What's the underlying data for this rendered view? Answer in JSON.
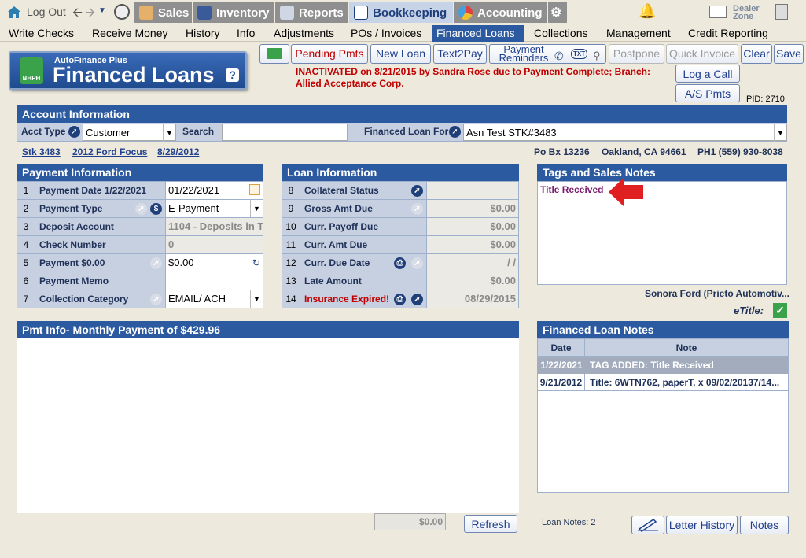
{
  "topbar": {
    "logout": "Log Out",
    "sales": "Sales",
    "inventory": "Inventory",
    "reports": "Reports",
    "bookkeeping": "Bookkeeping",
    "accounting": "Accounting",
    "dealer_zone": "Dealer Zone"
  },
  "menu": [
    "Write Checks",
    "Receive Money",
    "History",
    "Info",
    "Adjustments",
    "POs / Invoices",
    "Financed Loans",
    "Collections",
    "Management",
    "Credit Reporting"
  ],
  "logo": {
    "brand": "AutoFinance Plus",
    "title": "Financed Loans",
    "badge": "BHPH"
  },
  "toolbar": {
    "pending": "Pending Pmts",
    "new_loan": "New Loan",
    "text2pay": "Text2Pay",
    "reminders": "Payment Reminders",
    "txt": "TXT",
    "postpone": "Postpone",
    "quick_invoice": "Quick Invoice",
    "clear": "Clear",
    "save": "Save",
    "log_call": "Log a Call",
    "as_pmts": "A/S Pmts"
  },
  "alert": "INACTIVATED on 8/21/2015 by Sandra Rose due to Payment Complete; Branch: Allied Acceptance Corp.",
  "pid": "PID: 2710",
  "account": {
    "header": "Account Information",
    "acct_type_label": "Acct Type",
    "acct_type": "Customer",
    "search_label": "Search",
    "search_value": "",
    "financed_for_label": "Financed Loan For",
    "financed_for": "Asn Test STK#3483"
  },
  "vehicle": {
    "stock": "Stk 3483",
    "car": "2012 Ford Focus",
    "date": "8/29/2012"
  },
  "contact": {
    "address": "Po Bx 13236",
    "city": "Oakland, CA 94661",
    "phone": "PH1 (559) 930-8038"
  },
  "payment": {
    "header": "Payment Information",
    "rows": [
      {
        "n": "1",
        "label": "Payment Date  1/22/2021",
        "value": "01/22/2021"
      },
      {
        "n": "2",
        "label": "Payment Type",
        "value": "E-Payment"
      },
      {
        "n": "3",
        "label": "Deposit Account",
        "value": "1104 - Deposits in T"
      },
      {
        "n": "4",
        "label": "Check Number",
        "value": "0"
      },
      {
        "n": "5",
        "label": "Payment  $0.00",
        "value": "$0.00"
      },
      {
        "n": "6",
        "label": "Payment Memo",
        "value": ""
      },
      {
        "n": "7",
        "label": "Collection Category",
        "value": "EMAIL/ ACH"
      }
    ]
  },
  "loan": {
    "header": "Loan Information",
    "rows": [
      {
        "n": "8",
        "label": "Collateral Status",
        "value": ""
      },
      {
        "n": "9",
        "label": "Gross Amt Due",
        "value": "$0.00"
      },
      {
        "n": "10",
        "label": "Curr. Payoff Due",
        "value": "$0.00"
      },
      {
        "n": "11",
        "label": "Curr. Amt Due",
        "value": "$0.00"
      },
      {
        "n": "12",
        "label": "Curr. Due Date",
        "value": "/  /"
      },
      {
        "n": "13",
        "label": "Late Amount",
        "value": "$0.00"
      },
      {
        "n": "14",
        "label": "Insurance Expired!",
        "value": "08/29/2015"
      }
    ]
  },
  "tags": {
    "header": "Tags and Sales Notes",
    "items": [
      "Title Received"
    ]
  },
  "dealer": "Sonora Ford (Prieto Automotiv...",
  "etitle": "eTitle:",
  "pmt_info": {
    "header": "Pmt Info- Monthly Payment of $429.96",
    "total": "$0.00",
    "refresh": "Refresh"
  },
  "notes": {
    "header": "Financed Loan Notes",
    "col_date": "Date",
    "col_note": "Note",
    "rows": [
      {
        "date": "1/22/2021",
        "note": "TAG ADDED: Title Received"
      },
      {
        "date": "9/21/2012",
        "note": "Title:  6WTN762, paperT,  x 09/02/20137/14..."
      }
    ],
    "count_label": "Loan Notes:  2",
    "letter_history": "Letter History",
    "notes_btn": "Notes"
  },
  "colors": {
    "accent": "#2c5aa0",
    "alert": "#c00000",
    "tag": "#7a1a6e"
  }
}
